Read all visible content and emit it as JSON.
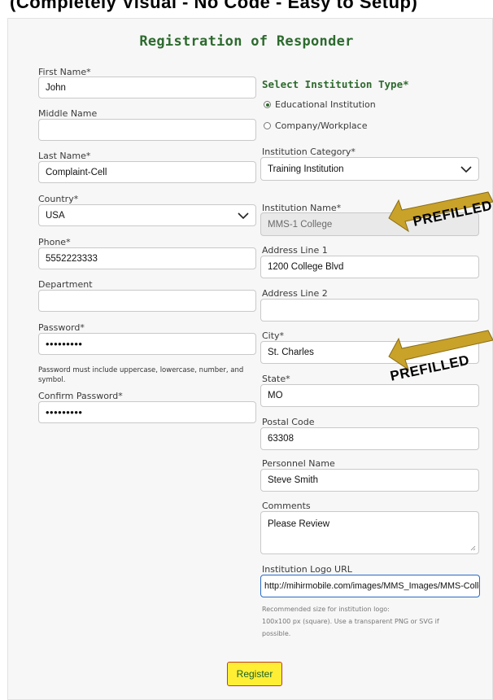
{
  "top_text": "(Completely Visual - No Code - Easy to Setup)",
  "form": {
    "title": "Registration of Responder",
    "left": {
      "first_name": {
        "label": "First Name*",
        "value": "John"
      },
      "middle_name": {
        "label": "Middle Name",
        "value": ""
      },
      "last_name": {
        "label": "Last Name*",
        "value": "Complaint-Cell"
      },
      "country": {
        "label": "Country*",
        "value": "USA"
      },
      "phone": {
        "label": "Phone*",
        "value": "5552223333"
      },
      "department": {
        "label": "Department",
        "value": ""
      },
      "password": {
        "label": "Password*",
        "value": "•••••••••"
      },
      "password_hint": "Password must include uppercase, lowercase, number, and symbol.",
      "confirm_password": {
        "label": "Confirm Password*",
        "value": "•••••••••"
      }
    },
    "right": {
      "institution_type_heading": "Select Institution Type*",
      "institution_type_options": [
        {
          "label": "Educational Institution",
          "checked": true
        },
        {
          "label": "Company/Workplace",
          "checked": false
        }
      ],
      "institution_category": {
        "label": "Institution Category*",
        "value": "Training Institution"
      },
      "institution_name": {
        "label": "Institution Name*",
        "value": "MMS-1 College"
      },
      "address1": {
        "label": "Address Line 1",
        "value": "1200 College Blvd"
      },
      "address2": {
        "label": "Address Line 2",
        "value": ""
      },
      "city": {
        "label": "City*",
        "value": "St. Charles"
      },
      "state": {
        "label": "State*",
        "value": "MO"
      },
      "postal_code": {
        "label": "Postal Code",
        "value": "63308"
      },
      "personnel_name": {
        "label": "Personnel Name",
        "value": "Steve Smith"
      },
      "comments": {
        "label": "Comments",
        "value": "Please Review"
      },
      "logo_url": {
        "label": "Institution Logo URL",
        "value": "http://mihirmobile.com/images/MMS_Images/MMS-College.png"
      },
      "logo_note_line1": "Recommended size for institution logo:",
      "logo_note_line2": "100x100 px (square). Use a transparent PNG or SVG if",
      "logo_note_line3": "possible."
    },
    "register_label": "Register"
  },
  "annotations": {
    "prefilled_1": "PREFILLED",
    "prefilled_2": "PREFILLED"
  },
  "colors": {
    "heading_green": "#2d6a2e",
    "button_bg": "#ffee33",
    "button_border": "#c53a2a",
    "arrow_fill": "#c9a22a"
  },
  "icons": {
    "dropdown": "chevron-down-icon",
    "annotation_arrow": "arrow-left-icon"
  }
}
